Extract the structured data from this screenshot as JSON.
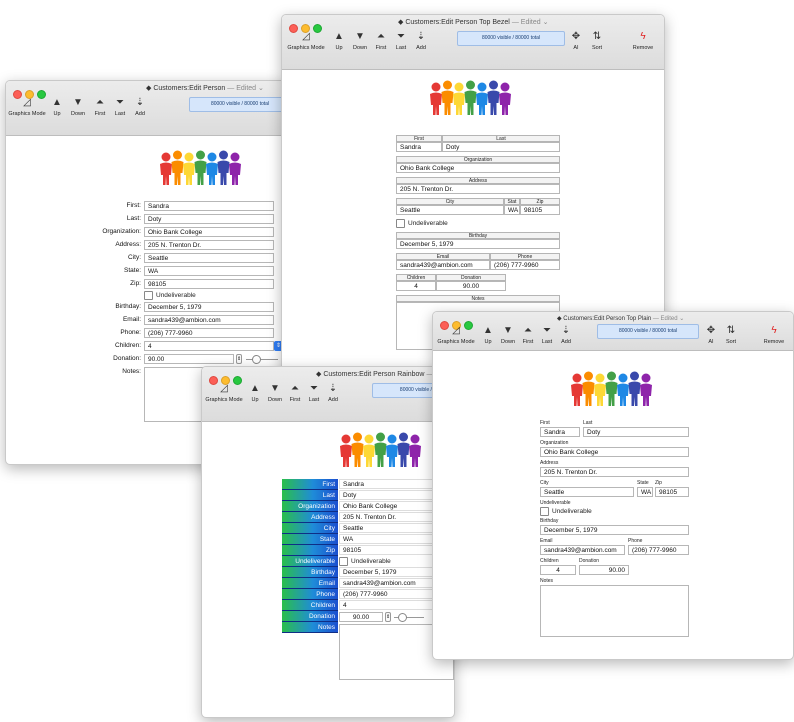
{
  "toolbar": {
    "graphics": "Graphics Mode",
    "up": "Up",
    "down": "Down",
    "first": "First",
    "last": "Last",
    "add": "Add",
    "ai": "AI",
    "sort": "Sort",
    "remove": "Remove"
  },
  "record_status": "80000 visible / 80000 total",
  "record_status_short": "80000 visible / 8",
  "windows": {
    "edit_person": {
      "title": "Customers:Edit Person",
      "edited": "— Edited ⌄"
    },
    "top_bezel": {
      "title": "Customers:Edit Person Top Bezel",
      "edited": "— Edited ⌄"
    },
    "rainbow": {
      "title": "Customers:Edit Person Rainbow",
      "edited": "— Edit"
    },
    "top_plain": {
      "title": "Customers:Edit Person Top Plain",
      "edited": "— Edited ⌄"
    }
  },
  "labels": {
    "first": "First",
    "last": "Last",
    "organization": "Organization",
    "address": "Address",
    "city": "City",
    "state": "State",
    "stat": "Stat",
    "zip": "Zip",
    "undeliverable": "Undeliverable",
    "birthday": "Birthday",
    "email": "Email",
    "phone": "Phone",
    "children": "Children",
    "donation": "Donation",
    "notes": "Notes",
    "first_c": "First:",
    "last_c": "Last:",
    "organization_c": "Organization:",
    "address_c": "Address:",
    "city_c": "City:",
    "state_c": "State:",
    "zip_c": "Zip:",
    "birthday_c": "Birthday:",
    "email_c": "Email:",
    "phone_c": "Phone:",
    "children_c": "Children:",
    "donation_c": "Donation:",
    "notes_c": "Notes:"
  },
  "record": {
    "first": "Sandra",
    "last": "Doty",
    "organization": "Ohio Bank College",
    "address": "205 N. Trenton Dr.",
    "city": "Seattle",
    "state": "WA",
    "zip": "98105",
    "birthday": "December 5, 1979",
    "email": "sandra439@ambion.com",
    "phone": "(206) 777-9960",
    "children": "4",
    "donation": "90.00"
  },
  "person_colors": [
    "#e53935",
    "#fb8c00",
    "#fdd835",
    "#43a047",
    "#1e88e5",
    "#3949ab",
    "#8e24aa"
  ]
}
